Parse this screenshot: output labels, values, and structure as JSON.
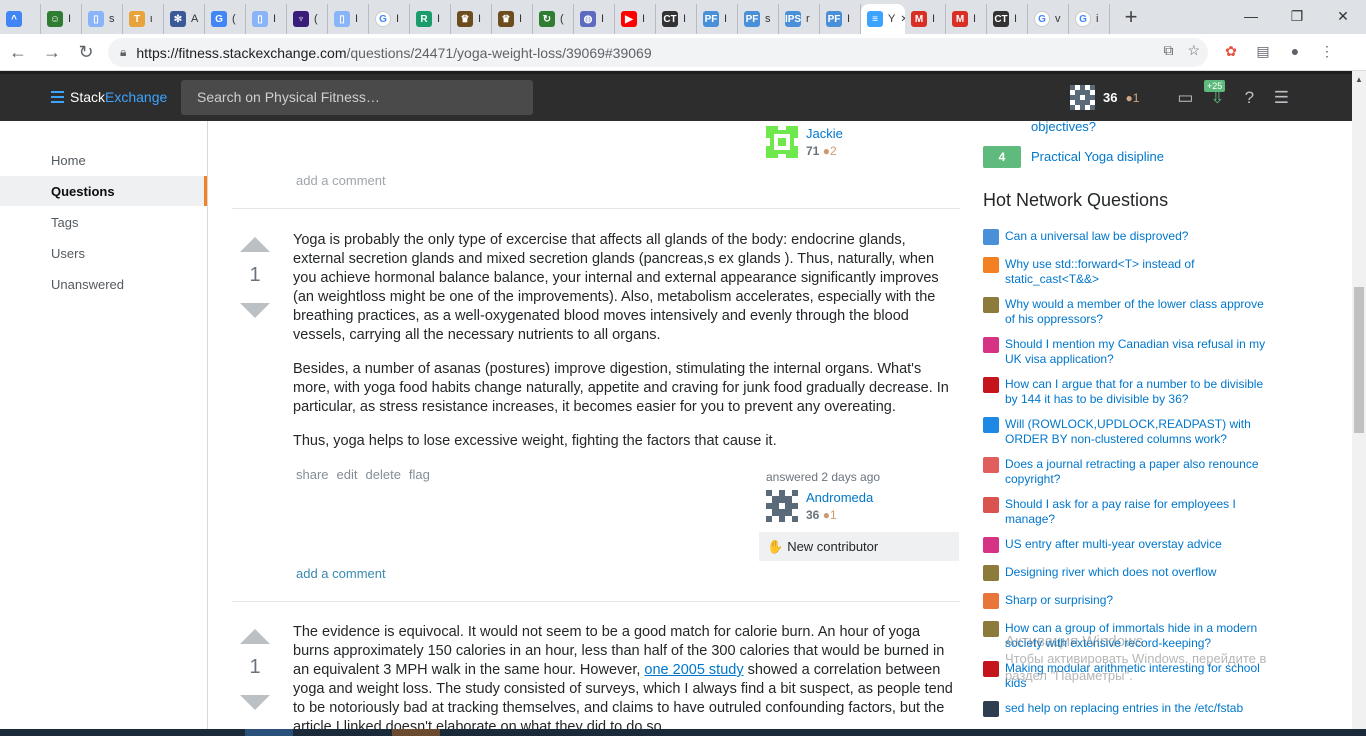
{
  "browser": {
    "tabs": [
      {
        "label": "",
        "color": "#4285f4",
        "glyph": "^"
      },
      {
        "label": "I",
        "color": "#2e7d32",
        "glyph": "☺"
      },
      {
        "label": "s",
        "color": "#8ab4f8",
        "glyph": "▯"
      },
      {
        "label": "ι",
        "color": "#e8a33d",
        "glyph": "T"
      },
      {
        "label": "A",
        "color": "#3b5998",
        "glyph": "✻"
      },
      {
        "label": "(",
        "color": "#4285f4",
        "glyph": "G"
      },
      {
        "label": "I",
        "color": "#8ab4f8",
        "glyph": "▯"
      },
      {
        "label": "(",
        "color": "#3a1d7a",
        "glyph": "♆"
      },
      {
        "label": "I",
        "color": "#8ab4f8",
        "glyph": "▯"
      },
      {
        "label": "I",
        "color": "#ffffff",
        "glyph": "G"
      },
      {
        "label": "I",
        "color": "#1a9c6b",
        "glyph": "R"
      },
      {
        "label": "I",
        "color": "#6d4c1e",
        "glyph": "♛"
      },
      {
        "label": "I",
        "color": "#6d4c1e",
        "glyph": "♛"
      },
      {
        "label": "(",
        "color": "#2e7d32",
        "glyph": "↻"
      },
      {
        "label": "I",
        "color": "#5c6bc0",
        "glyph": "◍"
      },
      {
        "label": "I",
        "color": "#ff0000",
        "glyph": "▶"
      },
      {
        "label": "I",
        "color": "#333333",
        "glyph": "CT"
      },
      {
        "label": "I",
        "color": "#4a90d9",
        "glyph": "PF"
      },
      {
        "label": "s",
        "color": "#4a90d9",
        "glyph": "PF"
      },
      {
        "label": "r",
        "color": "#4a90d9",
        "glyph": "IPS"
      },
      {
        "label": "I",
        "color": "#4a90d9",
        "glyph": "PF"
      },
      {
        "label": "Y",
        "color": "#3ca4ff",
        "glyph": "≡"
      },
      {
        "label": "I",
        "color": "#d93025",
        "glyph": "M"
      },
      {
        "label": "I",
        "color": "#d93025",
        "glyph": "M"
      },
      {
        "label": "I",
        "color": "#333333",
        "glyph": "CT"
      },
      {
        "label": "v",
        "color": "#ffffff",
        "glyph": "G"
      },
      {
        "label": "i",
        "color": "#ffffff",
        "glyph": "G"
      }
    ],
    "active_tab_index": 21,
    "new_tab": "+",
    "url_host": "https://fitness.stackexchange.com",
    "url_path": "/questions/24471/yoga-weight-loss/39069#39069"
  },
  "topbar": {
    "logo_stack": "Stack",
    "logo_exchange": "Exchange",
    "search_placeholder": "Search on Physical Fitness…",
    "rep": "36",
    "bronze": "●1",
    "achievements_badge": "+25"
  },
  "leftnav": {
    "items": [
      "Home",
      "Questions",
      "Tags",
      "Users",
      "Unanswered"
    ]
  },
  "prev_answer": {
    "user_name": "Jackie",
    "user_rep": "71",
    "user_bronze": "●2",
    "add_comment": "add a comment"
  },
  "answer1": {
    "votes": "1",
    "paragraphs": [
      "Yoga is probably the only type of excercise that affects all glands of the body: endocrine glands, external secretion glands and mixed secretion glands (pancreas,s ex glands ). Thus, naturally, when you achieve hormonal balance balance, your internal and external appearance significantly improves (an weightloss might be one of the improvements). Also, metabolism accelerates, especially with the breathing practices, as a well-oxygenated blood moves intensively and evenly through the blood vessels, carrying all the necessary nutrients to all organs.",
      "Besides, a number of asanas (postures) improve digestion, stimulating the internal organs. What's more, with yoga food habits change naturally, appetite and craving for junk food gradually decrease. In particular, as stress resistance increases, it becomes easier for you to prevent any overeating.",
      "Thus, yoga helps to lose excessive weight, fighting the factors that cause it."
    ],
    "menu": [
      "share",
      "edit",
      "delete",
      "flag"
    ],
    "answered": "answered 2 days ago",
    "user_name": "Andromeda",
    "user_rep": "36",
    "user_bronze": "●1",
    "new_contributor": "New contributor",
    "add_comment": "add a comment"
  },
  "answer2": {
    "votes": "1",
    "text_before_link": "The evidence is equivocal. It would not seem to be a good match for calorie burn. An hour of yoga burns approximately 150 calories in an hour, less than half of the 300 calories that would be burned in an equivalent 3 MPH walk in the same hour. However, ",
    "link_text": "one 2005 study",
    "text_after_link": " showed a correlation between yoga and weight loss. The study consisted of surveys, which I always find a bit suspect, as people tend to be notoriously bad at tracking themselves, and claims to have outruled confounding factors, but the article I linked doesn't elaborate on what they did to do so."
  },
  "sidebar": {
    "linked_prev": "objectives?",
    "linked_score": "4",
    "linked_title": "Practical Yoga disipline",
    "hnq_title": "Hot Network Questions",
    "hnq": [
      {
        "title": "Can a universal law be disproved?",
        "icon": "#4a90d9"
      },
      {
        "title": "Why use std::forward<T> instead of static_cast<T&&>",
        "icon": "#f48024"
      },
      {
        "title": "Why would a member of the lower class approve of his oppressors?",
        "icon": "#8c7b3a"
      },
      {
        "title": "Should I mention my Canadian visa refusal in my UK visa application?",
        "icon": "#d63384"
      },
      {
        "title": "How can I argue that for a number to be divisible by 144 it has to be divisible by 36?",
        "icon": "#c4151c"
      },
      {
        "title": "Will (ROWLOCK,UPDLOCK,READPAST) with ORDER BY non-clustered columns work?",
        "icon": "#1e88e5"
      },
      {
        "title": "Does a journal retracting a paper also renounce copyright?",
        "icon": "#e05e5e"
      },
      {
        "title": "Should I ask for a pay raise for employees I manage?",
        "icon": "#d9534f"
      },
      {
        "title": "US entry after multi-year overstay advice",
        "icon": "#d63384"
      },
      {
        "title": "Designing river which does not overflow",
        "icon": "#8c7b3a"
      },
      {
        "title": "Sharp or surprising?",
        "icon": "#e8753a"
      },
      {
        "title": "How can a group of immortals hide in a modern society with extensive record-keeping?",
        "icon": "#8c7b3a"
      },
      {
        "title": "Making modular arithmetic interesting for school kids",
        "icon": "#c4151c"
      },
      {
        "title": "sed help on replacing entries in the /etc/fstab",
        "icon": "#2c3e50"
      }
    ]
  },
  "watermark": {
    "line1": "Активация Windows",
    "line2": "Чтобы активировать Windows, перейдите в",
    "line3": "раздел \"Параметры\"."
  }
}
